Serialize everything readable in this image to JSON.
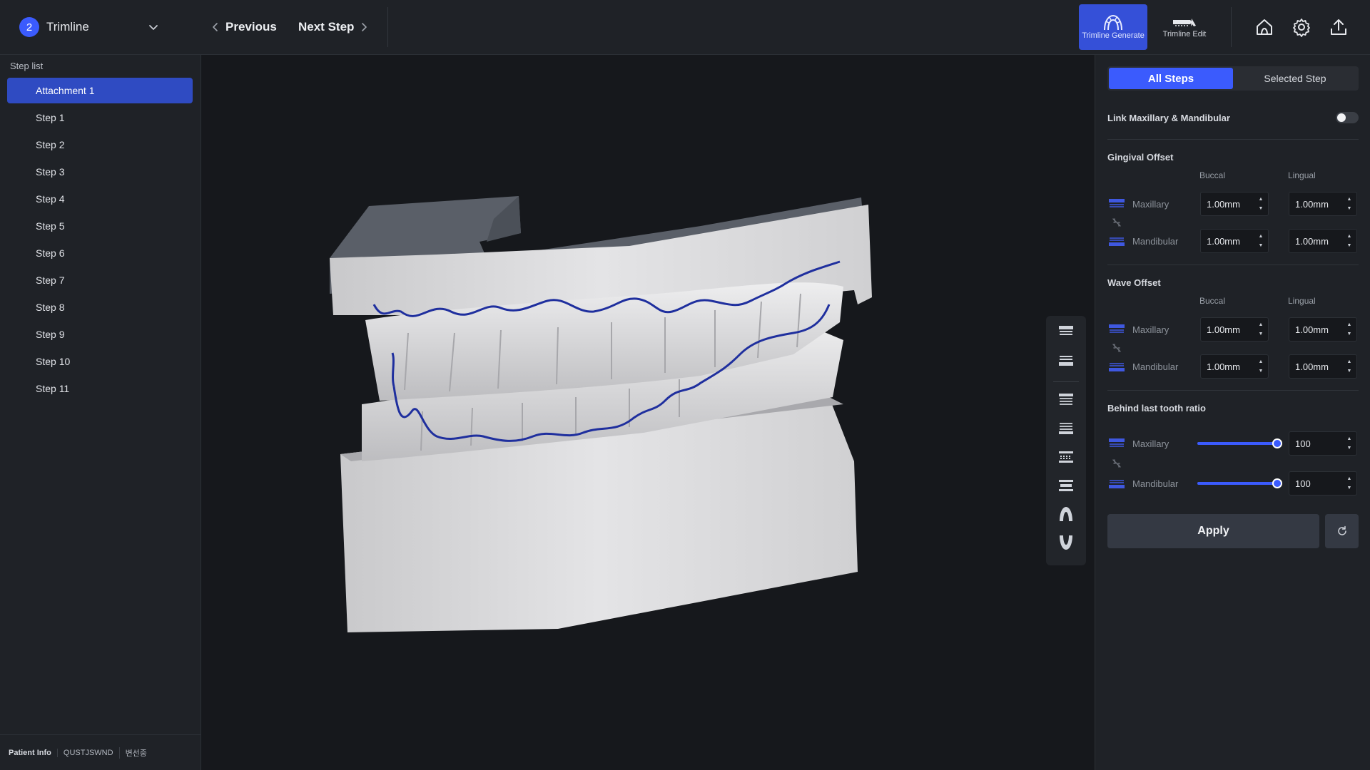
{
  "header": {
    "stage_number": "2",
    "stage_title": "Trimline",
    "prev_label": "Previous",
    "next_label": "Next Step",
    "tools": [
      {
        "label": "Trimline Generate",
        "icon": "arch-icon",
        "active": true
      },
      {
        "label": "Trimline Edit",
        "icon": "trimline-edit-icon",
        "active": false
      }
    ],
    "icons": [
      "home-icon",
      "gear-icon",
      "export-icon"
    ]
  },
  "sidebar": {
    "title": "Step list",
    "items": [
      "Attachment 1",
      "Step 1",
      "Step 2",
      "Step 3",
      "Step 4",
      "Step 5",
      "Step 6",
      "Step 7",
      "Step 8",
      "Step 9",
      "Step 10",
      "Step 11"
    ],
    "selected": "Attachment 1",
    "footer": {
      "patient_label": "Patient Info",
      "patient_id": "QUSTJSWND",
      "patient_name": "변선중"
    }
  },
  "view_toolbar": {
    "icons": [
      "view-maxillary-front-icon",
      "view-mandibular-front-icon",
      "view-upper-occlusal-icon",
      "view-lower-occlusal-icon",
      "view-left-icon",
      "view-right-icon",
      "view-upper-arch-icon",
      "view-lower-arch-icon"
    ]
  },
  "panel": {
    "scope_all": "All Steps",
    "scope_selected": "Selected Step",
    "scope_active": "All Steps",
    "link_label": "Link Maxillary & Mandibular",
    "link_on": false,
    "gingival": {
      "title": "Gingival Offset",
      "col_buccal": "Buccal",
      "col_lingual": "Lingual",
      "maxillary_label": "Maxillary",
      "mandibular_label": "Mandibular",
      "max_buccal": "1.00mm",
      "max_lingual": "1.00mm",
      "man_buccal": "1.00mm",
      "man_lingual": "1.00mm"
    },
    "wave": {
      "title": "Wave Offset",
      "col_buccal": "Buccal",
      "col_lingual": "Lingual",
      "maxillary_label": "Maxillary",
      "mandibular_label": "Mandibular",
      "max_buccal": "1.00mm",
      "max_lingual": "1.00mm",
      "man_buccal": "1.00mm",
      "man_lingual": "1.00mm"
    },
    "behind": {
      "title": "Behind last tooth ratio",
      "maxillary_label": "Maxillary",
      "mandibular_label": "Mandibular",
      "max_value": "100",
      "man_value": "100",
      "max_level": 1.0,
      "man_level": 1.0
    },
    "apply_label": "Apply"
  },
  "colors": {
    "accent": "#3b5bfd",
    "trimline": "#1f2f9e"
  }
}
